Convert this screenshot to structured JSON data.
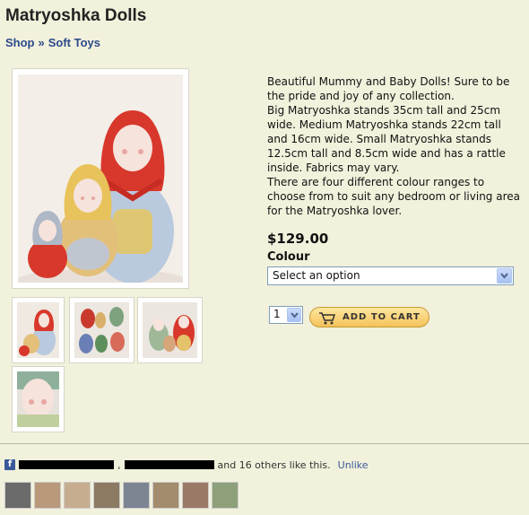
{
  "page": {
    "title": "Matryoshka Dolls"
  },
  "breadcrumb": {
    "items": [
      "Shop",
      "Soft Toys"
    ],
    "separator": "»"
  },
  "description": [
    "Beautiful Mummy and Baby Dolls! Sure to be the pride and joy of any collection.",
    "Big Matryoshka stands 35cm tall and 25cm wide. Medium Matryoshka stands 22cm tall and 16cm wide. Small Matryoshka stands 12.5cm tall and 8.5cm wide and has a rattle inside. Fabrics may vary.",
    "There are four different colour ranges to choose from to suit any bedroom or living area for the Matryoshka lover."
  ],
  "price": "$129.00",
  "colour": {
    "label": "Colour",
    "selected": "Select an option"
  },
  "quantity": {
    "value": "1"
  },
  "cart": {
    "label": "ADD TO CART"
  },
  "facebook": {
    "icon": "facebook-icon",
    "others_text": "and 16 others like this.",
    "unlike_label": "Unlike",
    "face_count": 8
  },
  "colors": {
    "background": "#f2f1dc",
    "link": "#2a4a8a",
    "cart_button": "#f4c25a",
    "facebook": "#3b5998"
  }
}
